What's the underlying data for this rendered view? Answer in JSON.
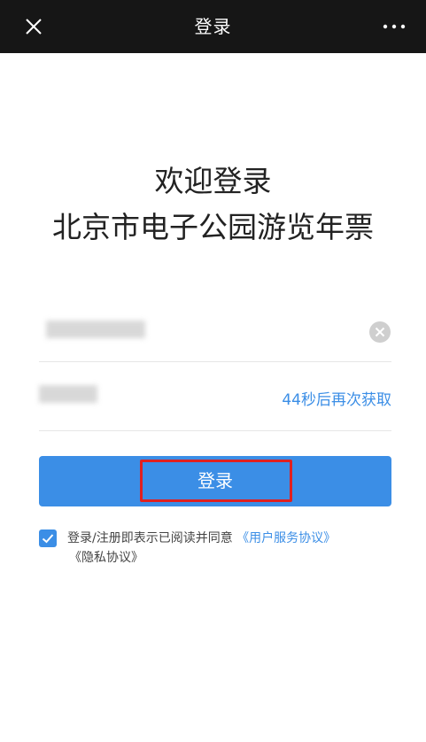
{
  "header": {
    "title": "登录",
    "close_icon": "close-icon",
    "more_icon": "more-icon"
  },
  "welcome": {
    "line1": "欢迎登录",
    "line2": "北京市电子公园游览年票"
  },
  "form": {
    "phone_value": "",
    "code_value": "",
    "resend_label": "44秒后再次获取"
  },
  "login_button": {
    "label": "登录"
  },
  "agreement": {
    "checked": true,
    "text": "登录/注册即表示已阅读并同意",
    "user_agreement": "《用户服务协议》",
    "privacy_policy": "《隐私协议》"
  },
  "colors": {
    "accent": "#3b8ee6",
    "topbar_bg": "#161616",
    "highlight_border": "#e02020"
  }
}
